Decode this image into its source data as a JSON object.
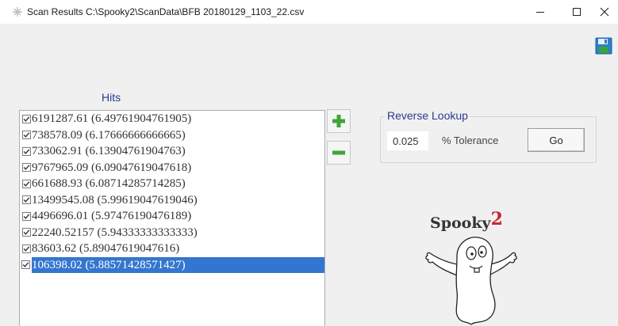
{
  "window": {
    "title": "Scan Results C:\\Spooky2\\ScanData\\BFB 20180129_1103_22.csv",
    "min_icon": "minimize-icon",
    "max_icon": "maximize-icon",
    "close_icon": "close-icon"
  },
  "toolbar": {
    "save_icon": "save-disk-icon"
  },
  "hits": {
    "label": "Hits",
    "items": [
      {
        "text": "6191287.61  (6.49761904761905)",
        "checked": true,
        "selected": false
      },
      {
        "text": "738578.09  (6.17666666666665)",
        "checked": true,
        "selected": false
      },
      {
        "text": "733062.91  (6.13904761904763)",
        "checked": true,
        "selected": false
      },
      {
        "text": "9767965.09  (6.09047619047618)",
        "checked": true,
        "selected": false
      },
      {
        "text": "661688.93  (6.08714285714285)",
        "checked": true,
        "selected": false
      },
      {
        "text": "13499545.08  (5.99619047619046)",
        "checked": true,
        "selected": false
      },
      {
        "text": "4496696.01  (5.97476190476189)",
        "checked": true,
        "selected": false
      },
      {
        "text": "22240.52157  (5.94333333333333)",
        "checked": true,
        "selected": false
      },
      {
        "text": "83603.62  (5.89047619047616)",
        "checked": true,
        "selected": false
      },
      {
        "text": "106398.02  (5.88571428571427)",
        "checked": true,
        "selected": true
      }
    ],
    "add_icon": "plus-icon",
    "remove_icon": "minus-icon"
  },
  "reverse_lookup": {
    "label": "Reverse Lookup",
    "tolerance_value": "0.025",
    "tolerance_label": "% Tolerance",
    "go_label": "Go"
  },
  "logo": {
    "text": "Spooky",
    "number": "2"
  },
  "colors": {
    "selection": "#3476cf",
    "group_label": "#2b3a8c",
    "add_green": "#3fa535",
    "logo_red": "#c8252c"
  }
}
